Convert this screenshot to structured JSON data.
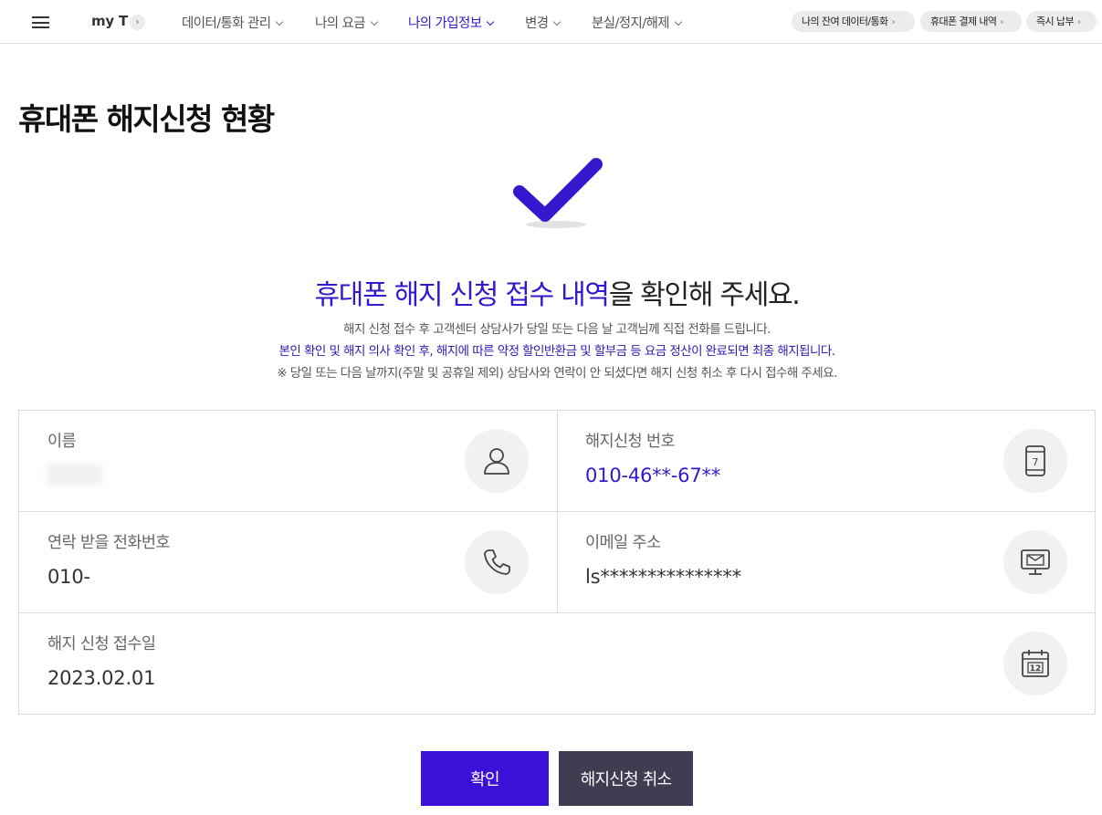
{
  "nav": {
    "brand": "my T",
    "brand_arrow": "›",
    "menu": [
      {
        "label": "데이터/통화 관리"
      },
      {
        "label": "나의 요금"
      },
      {
        "label": "나의 가입정보"
      },
      {
        "label": "변경"
      },
      {
        "label": "분실/정지/해제"
      }
    ],
    "active_menu": "나의 가입정보",
    "quick_links": [
      {
        "label": "나의 잔여 데이터/통화"
      },
      {
        "label": "휴대폰 결제 내역"
      },
      {
        "label": "즉시 납부"
      }
    ]
  },
  "page": {
    "title": "휴대폰 해지신청 현황",
    "headline_highlight": "휴대폰 해지 신청 접수 내역",
    "headline_rest": "을 확인해 주세요.",
    "notes": [
      "해지 신청 접수 후 고객센터 상담사가 당일 또는 다음 날 고객님께 직접 전화를 드립니다.",
      "본인 확인 및 해지 의사 확인 후, 해지에 따른 약정 할인반환금 및 할부금 등 요금 정산이 완료되면 최종 해지됩니다.",
      "※ 당일 또는 다음 날까지(주말 및 공휴일 제외) 상담사와 연락이 안 되셨다면 해지 신청 취소 후 다시 접수해 주세요."
    ]
  },
  "info": {
    "name": {
      "label": "이름",
      "value": "",
      "icon": "person-icon"
    },
    "request_number": {
      "label": "해지신청 번호",
      "value": "010-46**-67**",
      "icon": "mobile-phone-icon"
    },
    "contact_phone": {
      "label": "연락 받을 전화번호",
      "value": "010-",
      "icon": "phone-icon"
    },
    "email": {
      "label": "이메일 주소",
      "value": "ls***************",
      "icon": "monitor-mail-icon"
    },
    "request_date": {
      "label": "해지 신청 접수일",
      "value": "2023.02.01",
      "icon": "calendar-icon"
    }
  },
  "buttons": {
    "confirm": "확인",
    "cancel": "해지신청 취소"
  },
  "colors": {
    "accent": "#3617ce",
    "confirm_button": "#3d10d9",
    "cancel_button": "#403c52"
  }
}
